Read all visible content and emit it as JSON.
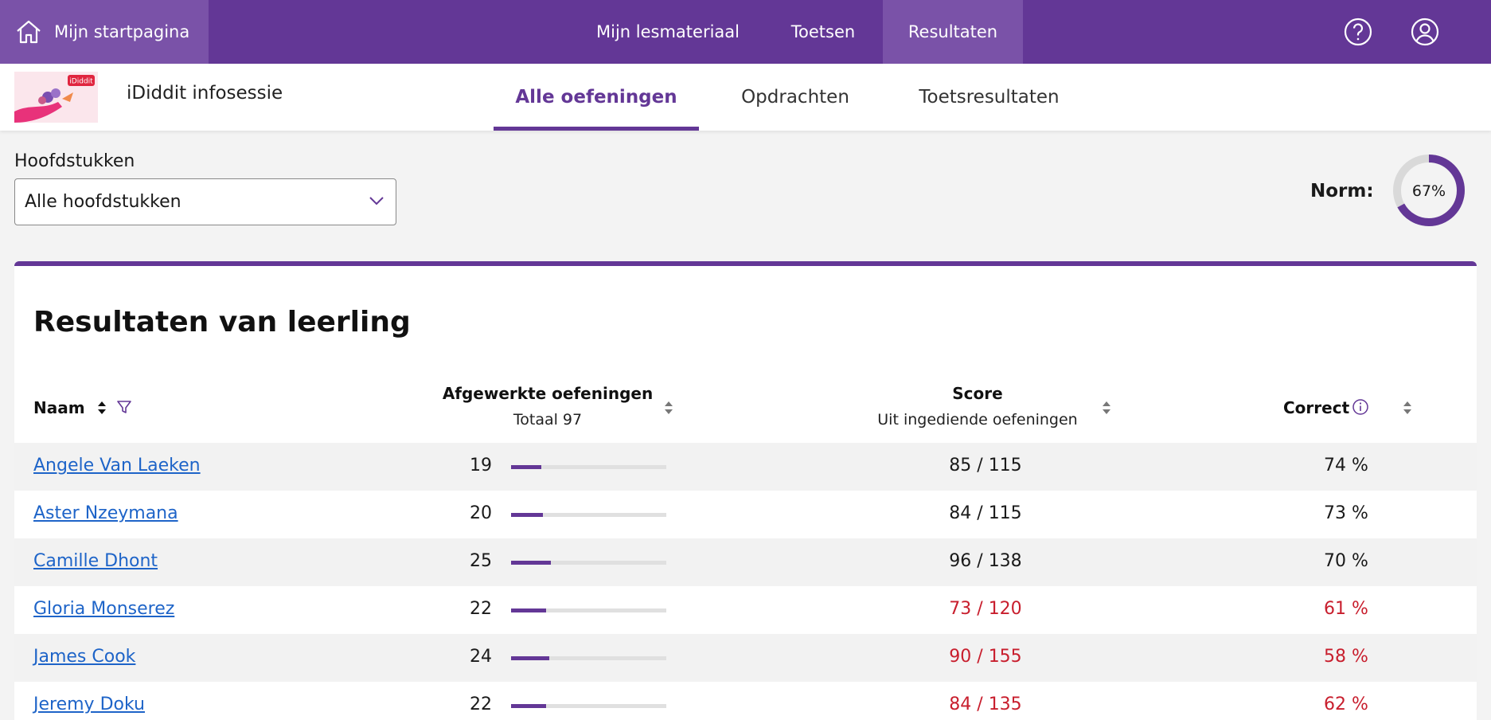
{
  "topbar": {
    "home_label": "Mijn startpagina",
    "nav": [
      {
        "label": "Mijn lesmateriaal"
      },
      {
        "label": "Toetsen"
      },
      {
        "label": "Resultaten",
        "active": true
      }
    ],
    "icons": [
      "help-icon",
      "user-icon"
    ]
  },
  "course": {
    "thumbnail_badge": "iDiddit",
    "title": "iDiddit infosessie",
    "tabs": [
      {
        "label": "Alle oefeningen",
        "active": true
      },
      {
        "label": "Opdrachten"
      },
      {
        "label": "Toetsresultaten"
      }
    ]
  },
  "filter": {
    "label": "Hoofdstukken",
    "selected": "Alle hoofdstukken"
  },
  "norm": {
    "label": "Norm:",
    "value_text": "67%",
    "value": 0.67
  },
  "results": {
    "title": "Resultaten van leerling",
    "columns": {
      "name": "Naam",
      "completed": "Afgewerkte oefeningen",
      "completed_sub": "Totaal 97",
      "score": "Score",
      "score_sub": "Uit ingediende oefeningen",
      "correct": "Correct"
    },
    "total_exercises": 97,
    "rows": [
      {
        "name": "Angele Van Laeken",
        "completed": "19",
        "progress": 0.196,
        "score": "85 / 115",
        "correct": "74 %",
        "below_norm": false
      },
      {
        "name": "Aster Nzeymana",
        "completed": "20",
        "progress": 0.206,
        "score": "84 / 115",
        "correct": "73 %",
        "below_norm": false
      },
      {
        "name": "Camille Dhont",
        "completed": "25",
        "progress": 0.258,
        "score": "96 / 138",
        "correct": "70 %",
        "below_norm": false
      },
      {
        "name": "Gloria Monserez",
        "completed": "22",
        "progress": 0.227,
        "score": "73 / 120",
        "correct": "61 %",
        "below_norm": true
      },
      {
        "name": "James Cook",
        "completed": "24",
        "progress": 0.247,
        "score": "90 / 155",
        "correct": "58 %",
        "below_norm": true
      },
      {
        "name": "Jeremy Doku",
        "completed": "22",
        "progress": 0.227,
        "score": "84 / 135",
        "correct": "62 %",
        "below_norm": true
      }
    ]
  },
  "colors": {
    "brand": "#633796",
    "brand_light": "#7a52a8",
    "link": "#1e64c8",
    "below_norm": "#c81e2d"
  }
}
